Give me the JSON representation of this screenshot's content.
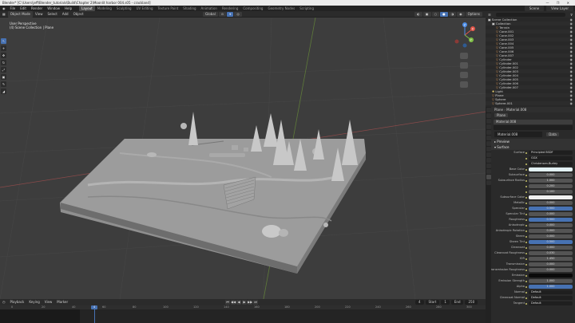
{
  "window": {
    "title": "Blender* [C:\\Users\\jeff\\Blender_tutorials\\Build\\Chapter 2\\Moonlit harbor 004.s05 - crackland]",
    "controls": "—  ❐  ✕"
  },
  "menu": {
    "items": [
      "File",
      "Edit",
      "Render",
      "Window",
      "Help"
    ],
    "workspaces": [
      "Layout",
      "Modeling",
      "Sculpting",
      "UV Editing",
      "Texture Paint",
      "Shading",
      "Animation",
      "Rendering",
      "Compositing",
      "Geometry Nodes",
      "Scripting"
    ],
    "active_workspace": "Layout",
    "scene": "Scene",
    "view_layer": "View Layer"
  },
  "viewport_header": {
    "mode": "Object Mode",
    "menus": [
      "View",
      "Select",
      "Add",
      "Object"
    ],
    "transform": "Global",
    "right_buttons": [
      "Options"
    ]
  },
  "viewport": {
    "view_name": "User Perspective",
    "collection_path": "(4) Scene Collection | Plane",
    "toolbar": [
      "↖",
      "+",
      "✥",
      "↻",
      "⤢",
      "▣",
      "✎",
      "◢"
    ],
    "gizmo_axes": [
      "X",
      "Y",
      "Z"
    ]
  },
  "timeline_header": {
    "menus": [
      "Playback",
      "Keying",
      "View",
      "Marker"
    ],
    "playback_icons": [
      "⏮",
      "◀◀",
      "◀",
      "▶",
      "▶▶",
      "⏭"
    ],
    "current_frame": "4",
    "start_label": "Start",
    "start": "1",
    "end_label": "End",
    "end": "250"
  },
  "timeline": {
    "ticks": [
      "0",
      "20",
      "40",
      "60",
      "80",
      "100",
      "120",
      "140",
      "160",
      "180",
      "200",
      "220",
      "240",
      "260",
      "280",
      "300"
    ],
    "playhead": "4"
  },
  "outliner": {
    "header": "Scene Collection",
    "rows": [
      {
        "name": "Scene Collection",
        "kind": "col",
        "indent": 0
      },
      {
        "name": "Collection",
        "kind": "col",
        "indent": 1
      },
      {
        "name": "Terrain",
        "kind": "mesh",
        "indent": 2
      },
      {
        "name": "Cone.001",
        "kind": "mesh",
        "indent": 2
      },
      {
        "name": "Cone.002",
        "kind": "mesh",
        "indent": 2
      },
      {
        "name": "Cone.003",
        "kind": "mesh",
        "indent": 2
      },
      {
        "name": "Cone.004",
        "kind": "mesh",
        "indent": 2
      },
      {
        "name": "Cone.005",
        "kind": "mesh",
        "indent": 2
      },
      {
        "name": "Cone.006",
        "kind": "mesh",
        "indent": 2
      },
      {
        "name": "Cone.007",
        "kind": "mesh",
        "indent": 2
      },
      {
        "name": "Cylinder",
        "kind": "mesh",
        "indent": 2
      },
      {
        "name": "Cylinder.001",
        "kind": "mesh",
        "indent": 2
      },
      {
        "name": "Cylinder.002",
        "kind": "mesh",
        "indent": 2
      },
      {
        "name": "Cylinder.003",
        "kind": "mesh",
        "indent": 2
      },
      {
        "name": "Cylinder.004",
        "kind": "mesh",
        "indent": 2
      },
      {
        "name": "Cylinder.005",
        "kind": "mesh",
        "indent": 2
      },
      {
        "name": "Cylinder.006",
        "kind": "mesh",
        "indent": 2
      },
      {
        "name": "Cylinder.007",
        "kind": "mesh",
        "indent": 2
      },
      {
        "name": "Light",
        "kind": "light",
        "indent": 1
      },
      {
        "name": "Plane",
        "kind": "mesh",
        "indent": 1
      },
      {
        "name": "Sphere",
        "kind": "mesh",
        "indent": 1
      },
      {
        "name": "Sphere.001",
        "kind": "mesh",
        "indent": 1
      }
    ]
  },
  "properties": {
    "tabs": 14,
    "object_name": "Plane",
    "header_buttons": [
      "Plane",
      "Material.008"
    ],
    "slots": [
      "Material.008",
      ""
    ],
    "material_field": "Material.008",
    "material_extra": "Data",
    "sections": [
      "Preview",
      "Surface"
    ],
    "surface_shader": "Principled BSDF",
    "rows": [
      {
        "label": "Surface",
        "value": "Principled BSDF",
        "style": "dark"
      },
      {
        "label": "",
        "value": "GGX",
        "style": "dark"
      },
      {
        "label": "",
        "value": "Christensen-Burley",
        "style": "dark"
      },
      {
        "label": "Base Color",
        "value": "",
        "style": "light"
      },
      {
        "label": "Subsurface",
        "value": "0.000",
        "style": "plain"
      },
      {
        "label": "Subsurface Radius",
        "value": "1.000",
        "style": "plain"
      },
      {
        "label": "",
        "value": "0.200",
        "style": "plain"
      },
      {
        "label": "",
        "value": "0.100",
        "style": "plain"
      },
      {
        "label": "Subsurface Color",
        "value": "",
        "style": "white"
      },
      {
        "label": "Metallic",
        "value": "0.000",
        "style": "plain"
      },
      {
        "label": "Specular",
        "value": "0.500",
        "style": "blue"
      },
      {
        "label": "Specular Tint",
        "value": "0.000",
        "style": "plain"
      },
      {
        "label": "Roughness",
        "value": "0.500",
        "style": "blue"
      },
      {
        "label": "Anisotropic",
        "value": "0.000",
        "style": "plain"
      },
      {
        "label": "Anisotropic Rotation",
        "value": "0.000",
        "style": "plain"
      },
      {
        "label": "Sheen",
        "value": "0.000",
        "style": "plain"
      },
      {
        "label": "Sheen Tint",
        "value": "0.500",
        "style": "blue"
      },
      {
        "label": "Clearcoat",
        "value": "0.000",
        "style": "plain"
      },
      {
        "label": "Clearcoat Roughness",
        "value": "0.030",
        "style": "plain"
      },
      {
        "label": "IOR",
        "value": "1.450",
        "style": "plain"
      },
      {
        "label": "Transmission",
        "value": "0.000",
        "style": "plain"
      },
      {
        "label": "Transmission Roughness",
        "value": "0.000",
        "style": "plain"
      },
      {
        "label": "Emission",
        "value": "",
        "style": "black"
      },
      {
        "label": "Emission Strength",
        "value": "1.000",
        "style": "plain"
      },
      {
        "label": "Alpha",
        "value": "1.000",
        "style": "blue"
      },
      {
        "label": "Normal",
        "value": "Default",
        "style": "dark"
      },
      {
        "label": "Clearcoat Normal",
        "value": "Default",
        "style": "dark"
      },
      {
        "label": "Tangent",
        "value": "Default",
        "style": "dark"
      }
    ]
  },
  "colors": {
    "accent": "#4772b3",
    "viewport_bg": "#3d3d3d",
    "mesh_orange": "#e49a54"
  }
}
